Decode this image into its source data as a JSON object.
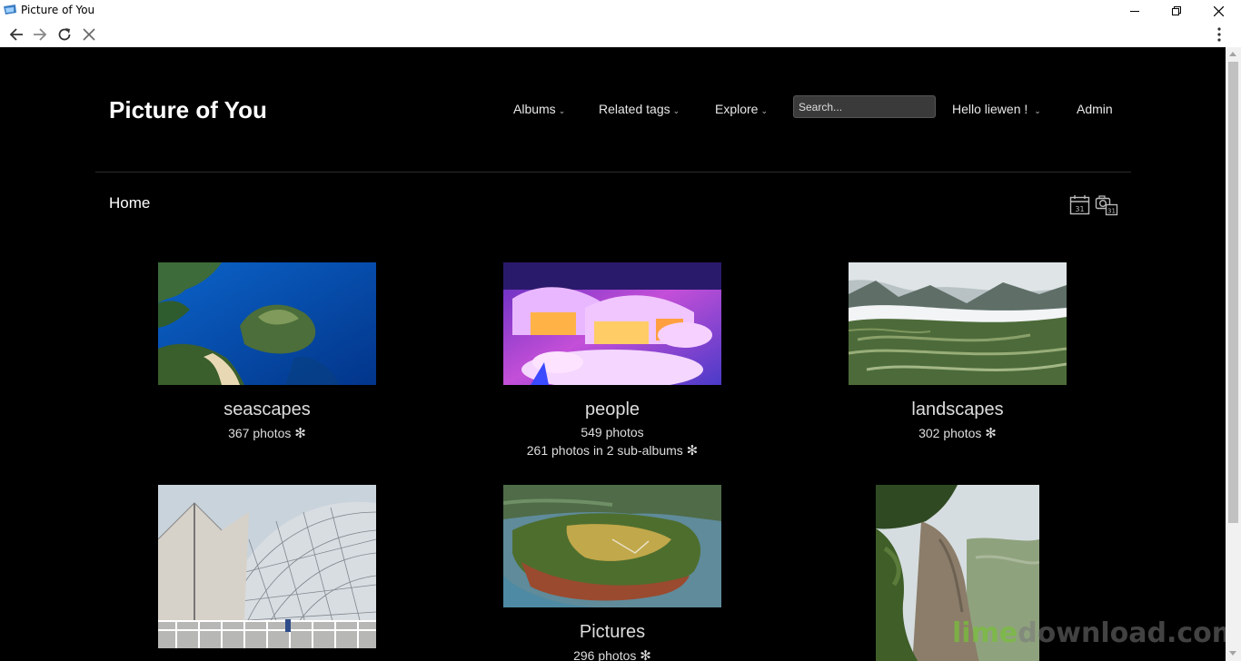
{
  "window": {
    "title": "Picture of You"
  },
  "site": {
    "title": "Picture of You"
  },
  "menu": {
    "albums": "Albums",
    "related_tags": "Related tags",
    "explore": "Explore",
    "search_placeholder": "Search...",
    "user": "Hello liewen !",
    "admin": "Admin",
    "caret": "⌄"
  },
  "breadcrumb": "Home",
  "albums": [
    {
      "name": "seascapes",
      "count": "367 photos",
      "marker": "✻"
    },
    {
      "name": "people",
      "count": "549 photos",
      "sub": "261 photos in 2 sub-albums",
      "marker": "✻"
    },
    {
      "name": "landscapes",
      "count": "302 photos",
      "marker": "✻"
    },
    {
      "name": "",
      "count": ""
    },
    {
      "name": "Pictures",
      "count": "296 photos",
      "marker": "✻"
    },
    {
      "name": "",
      "count": ""
    }
  ],
  "icons": {
    "calendar_day": "31",
    "calendar_photo_day": "31"
  },
  "watermark": {
    "lime": "lime",
    "rest": "download.com"
  }
}
